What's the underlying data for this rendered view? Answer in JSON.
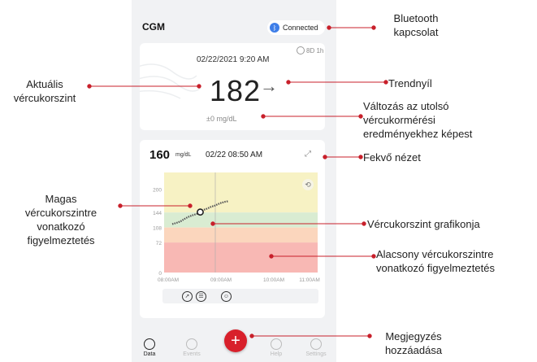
{
  "app": {
    "title": "CGM",
    "bluetooth_status": "Connected"
  },
  "current_card": {
    "sensor_badge": "8D 1h",
    "datetime": "02/22/2021  9:20 AM",
    "value": "182",
    "trend_symbol": "→",
    "delta": "±0 mg/dL"
  },
  "chart_card": {
    "value": "160",
    "unit": "mg/dL",
    "datetime": "02/22  08:50 AM",
    "expand_symbol": "⤢"
  },
  "chart_data": {
    "type": "line",
    "y_ticks": [
      "200",
      "144",
      "108",
      "72",
      "0"
    ],
    "x_ticks": [
      "08:00AM",
      "09:00AM",
      "10:00AM",
      "11:00AM"
    ],
    "bands": [
      {
        "name": "high",
        "from": 144,
        "to": 240,
        "color": "#f7f2c4"
      },
      {
        "name": "target",
        "from": 108,
        "to": 144,
        "color": "#d9ecd2"
      },
      {
        "name": "low-warning",
        "from": 72,
        "to": 108,
        "color": "#fbd6bd"
      },
      {
        "name": "low",
        "from": 0,
        "to": 72,
        "color": "#f8b8b4"
      }
    ],
    "points": [
      {
        "x": 0.0,
        "y": 116
      },
      {
        "x": 0.03,
        "y": 118
      },
      {
        "x": 0.06,
        "y": 120
      },
      {
        "x": 0.09,
        "y": 123
      },
      {
        "x": 0.12,
        "y": 127
      },
      {
        "x": 0.15,
        "y": 131
      },
      {
        "x": 0.18,
        "y": 134
      },
      {
        "x": 0.21,
        "y": 137
      },
      {
        "x": 0.24,
        "y": 139
      },
      {
        "x": 0.27,
        "y": 141
      },
      {
        "x": 0.3,
        "y": 145
      },
      {
        "x": 0.33,
        "y": 150
      },
      {
        "x": 0.36,
        "y": 152
      },
      {
        "x": 0.39,
        "y": 155
      },
      {
        "x": 0.42,
        "y": 158
      },
      {
        "x": 0.45,
        "y": 160
      },
      {
        "x": 0.48,
        "y": 163
      },
      {
        "x": 0.51,
        "y": 166
      },
      {
        "x": 0.54,
        "y": 168
      },
      {
        "x": 0.57,
        "y": 170
      },
      {
        "x": 0.6,
        "y": 171
      }
    ],
    "selected_index": 10
  },
  "icons": {
    "sensor": "sensor-icon",
    "reset": "refresh-icon",
    "expand": "expand-icon"
  },
  "mini_icons": [
    "compass-icon",
    "pill-icon",
    "person-icon"
  ],
  "nav": [
    {
      "label": "Data",
      "active": true
    },
    {
      "label": "Events",
      "active": false
    },
    {
      "label": "Help",
      "active": false
    },
    {
      "label": "Settings",
      "active": false
    }
  ],
  "fab_symbol": "+",
  "callouts": {
    "bluetooth": "Bluetooth\nkapcsolat",
    "current_level": "Aktuális\nvércukorszint",
    "trend": "Trendnyíl",
    "change": "Változás az utolsó\nvércukormérési\neredményekhez képest",
    "landscape": "Fekvő nézet",
    "high_alert": "Magas\nvércukorszintre\nvonatkozó\nfigyelmeztetés",
    "graph": "Vércukorszint grafikonja",
    "low_alert": "Alacsony vércukorszintre\nvonatkozó figyelmeztetés",
    "add_note": "Megjegyzés\nhozzáadása"
  },
  "colors": {
    "accent": "#d8202b",
    "bluetooth": "#3e7ee8"
  }
}
